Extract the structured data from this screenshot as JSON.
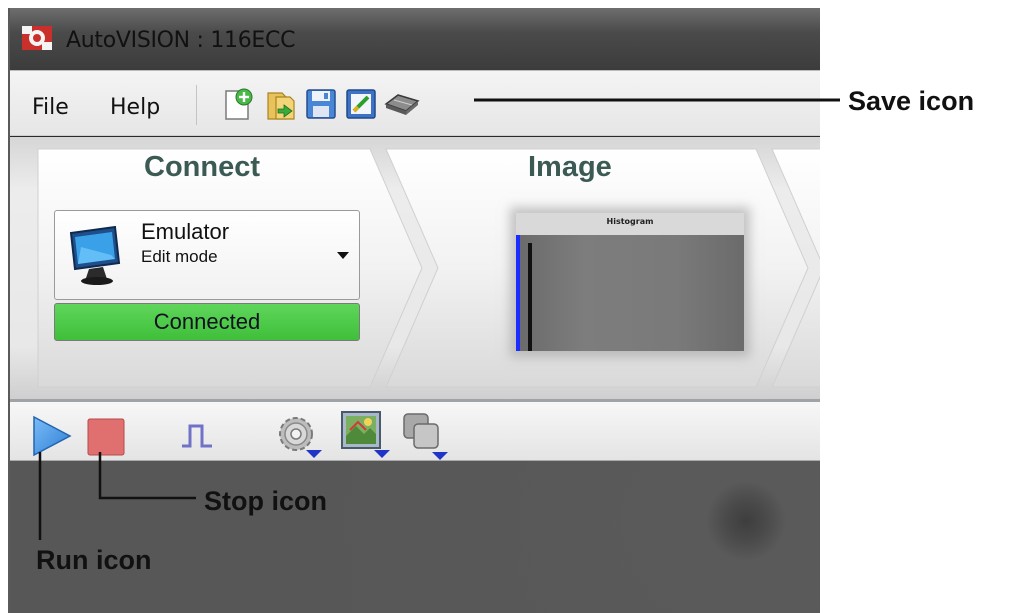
{
  "window": {
    "title": "AutoVISION : 116ECC"
  },
  "menu": {
    "file": "File",
    "help": "Help",
    "toolbar_icons": [
      "new-job-icon",
      "open-job-icon",
      "save-icon",
      "edit-icon",
      "device-chip-icon"
    ]
  },
  "workflow": {
    "connect": {
      "label": "Connect",
      "device_name": "Emulator",
      "device_mode": "Edit mode",
      "status": "Connected",
      "status_color": "#4cc947"
    },
    "image": {
      "label": "Image",
      "histogram_title": "Histogram"
    }
  },
  "run_toolbar": {
    "icons": [
      "run-icon",
      "stop-icon",
      "trigger-pulse-icon",
      "settings-gear-icon",
      "image-view-icon",
      "copy-layers-icon"
    ],
    "run_color": "#3b8ee6",
    "stop_color": "#e06a6a"
  },
  "callouts": {
    "save": "Save icon",
    "stop": "Stop icon",
    "run": "Run icon"
  }
}
